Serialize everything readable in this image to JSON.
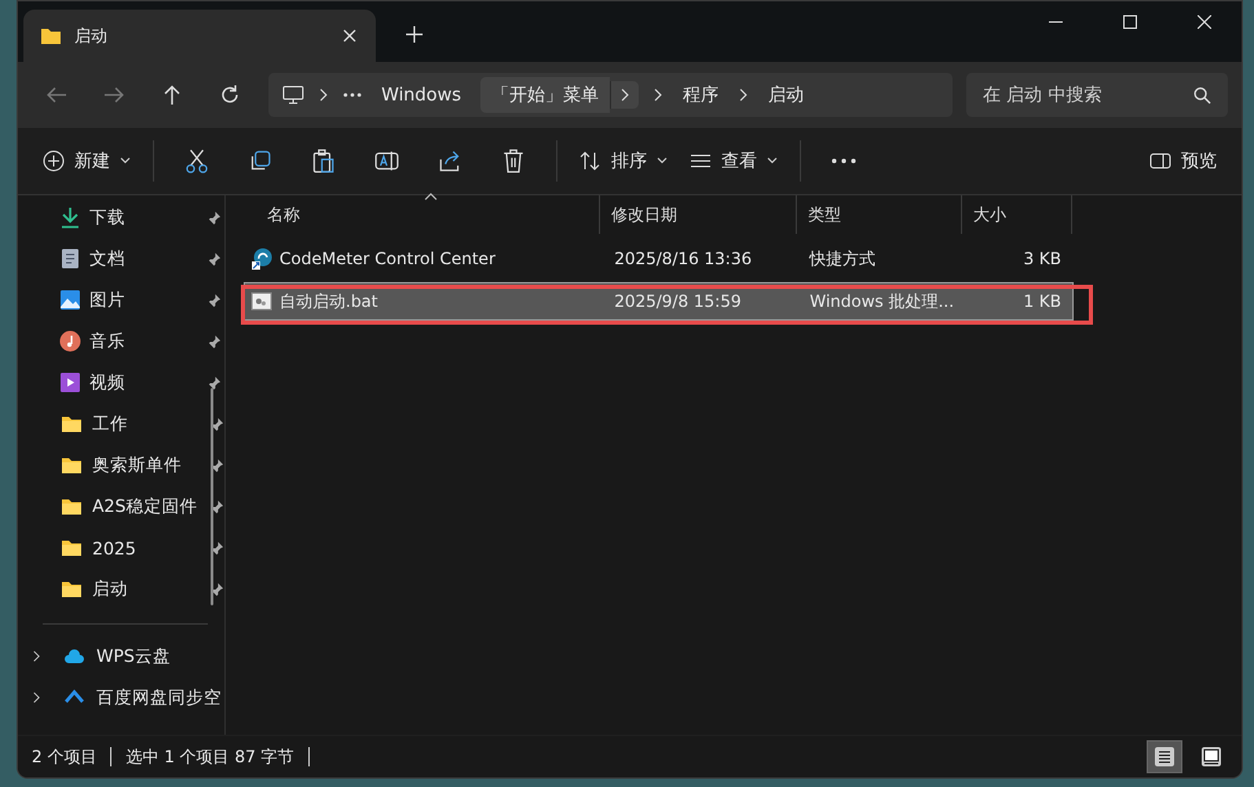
{
  "window": {
    "title": "启动"
  },
  "address": {
    "crumbs": [
      {
        "label": "Windows",
        "selected": false
      },
      {
        "label": "「开始」菜单",
        "selected": true
      },
      {
        "label": "程序",
        "selected": false
      },
      {
        "label": "启动",
        "selected": false
      }
    ],
    "search_placeholder": "在 启动 中搜索"
  },
  "toolbar": {
    "new": "新建",
    "sort": "排序",
    "view": "查看",
    "preview": "预览"
  },
  "sidebar": {
    "items": [
      {
        "label": "下载",
        "kind": "download",
        "pinned": true
      },
      {
        "label": "文档",
        "kind": "document",
        "pinned": true
      },
      {
        "label": "图片",
        "kind": "picture",
        "pinned": true
      },
      {
        "label": "音乐",
        "kind": "music",
        "pinned": true
      },
      {
        "label": "视频",
        "kind": "video",
        "pinned": true
      },
      {
        "label": "工作",
        "kind": "folder",
        "pinned": true
      },
      {
        "label": "奥索斯单件",
        "kind": "folder",
        "pinned": true
      },
      {
        "label": "A2S稳定固件",
        "kind": "folder",
        "pinned": true
      },
      {
        "label": "2025",
        "kind": "folder",
        "pinned": true
      },
      {
        "label": "启动",
        "kind": "folder",
        "pinned": true
      }
    ],
    "drives": [
      {
        "label": "WPS云盘",
        "kind": "cloud"
      },
      {
        "label": "百度网盘同步空",
        "kind": "sync"
      }
    ]
  },
  "table": {
    "columns": [
      "名称",
      "修改日期",
      "类型",
      "大小"
    ],
    "rows": [
      {
        "name": "CodeMeter Control Center",
        "date": "2025/8/16 13:36",
        "type": "快捷方式",
        "size": "3 KB",
        "kind": "shortcut",
        "selected": false
      },
      {
        "name": "自动启动.bat",
        "date": "2025/9/8 15:59",
        "type": "Windows 批处理...",
        "size": "1 KB",
        "kind": "batch",
        "selected": true
      }
    ]
  },
  "status_bar": {
    "count": "2 个项目",
    "selection": "选中 1 个项目  87 字节",
    "views": [
      {
        "kind": "details",
        "selected": true
      },
      {
        "kind": "preview",
        "selected": false
      }
    ]
  }
}
